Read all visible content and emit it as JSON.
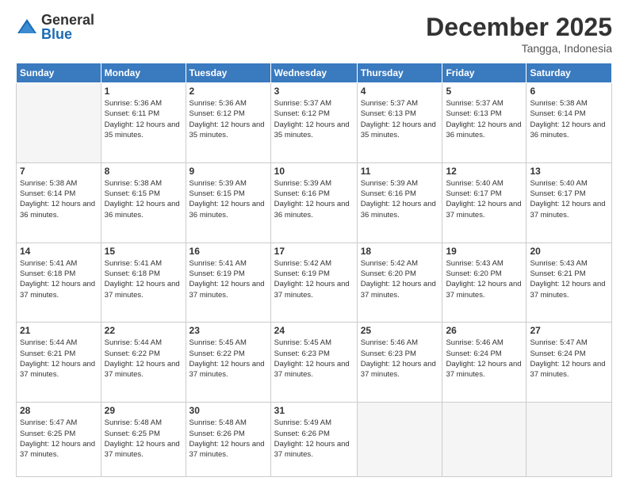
{
  "logo": {
    "general": "General",
    "blue": "Blue"
  },
  "title": "December 2025",
  "subtitle": "Tangga, Indonesia",
  "days_of_week": [
    "Sunday",
    "Monday",
    "Tuesday",
    "Wednesday",
    "Thursday",
    "Friday",
    "Saturday"
  ],
  "weeks": [
    [
      {
        "day": "",
        "sunrise": "",
        "sunset": "",
        "daylight": ""
      },
      {
        "day": "1",
        "sunrise": "5:36 AM",
        "sunset": "6:11 PM",
        "daylight": "12 hours and 35 minutes."
      },
      {
        "day": "2",
        "sunrise": "5:36 AM",
        "sunset": "6:12 PM",
        "daylight": "12 hours and 35 minutes."
      },
      {
        "day": "3",
        "sunrise": "5:37 AM",
        "sunset": "6:12 PM",
        "daylight": "12 hours and 35 minutes."
      },
      {
        "day": "4",
        "sunrise": "5:37 AM",
        "sunset": "6:13 PM",
        "daylight": "12 hours and 35 minutes."
      },
      {
        "day": "5",
        "sunrise": "5:37 AM",
        "sunset": "6:13 PM",
        "daylight": "12 hours and 36 minutes."
      },
      {
        "day": "6",
        "sunrise": "5:38 AM",
        "sunset": "6:14 PM",
        "daylight": "12 hours and 36 minutes."
      }
    ],
    [
      {
        "day": "7",
        "sunrise": "5:38 AM",
        "sunset": "6:14 PM",
        "daylight": "12 hours and 36 minutes."
      },
      {
        "day": "8",
        "sunrise": "5:38 AM",
        "sunset": "6:15 PM",
        "daylight": "12 hours and 36 minutes."
      },
      {
        "day": "9",
        "sunrise": "5:39 AM",
        "sunset": "6:15 PM",
        "daylight": "12 hours and 36 minutes."
      },
      {
        "day": "10",
        "sunrise": "5:39 AM",
        "sunset": "6:16 PM",
        "daylight": "12 hours and 36 minutes."
      },
      {
        "day": "11",
        "sunrise": "5:39 AM",
        "sunset": "6:16 PM",
        "daylight": "12 hours and 36 minutes."
      },
      {
        "day": "12",
        "sunrise": "5:40 AM",
        "sunset": "6:17 PM",
        "daylight": "12 hours and 37 minutes."
      },
      {
        "day": "13",
        "sunrise": "5:40 AM",
        "sunset": "6:17 PM",
        "daylight": "12 hours and 37 minutes."
      }
    ],
    [
      {
        "day": "14",
        "sunrise": "5:41 AM",
        "sunset": "6:18 PM",
        "daylight": "12 hours and 37 minutes."
      },
      {
        "day": "15",
        "sunrise": "5:41 AM",
        "sunset": "6:18 PM",
        "daylight": "12 hours and 37 minutes."
      },
      {
        "day": "16",
        "sunrise": "5:41 AM",
        "sunset": "6:19 PM",
        "daylight": "12 hours and 37 minutes."
      },
      {
        "day": "17",
        "sunrise": "5:42 AM",
        "sunset": "6:19 PM",
        "daylight": "12 hours and 37 minutes."
      },
      {
        "day": "18",
        "sunrise": "5:42 AM",
        "sunset": "6:20 PM",
        "daylight": "12 hours and 37 minutes."
      },
      {
        "day": "19",
        "sunrise": "5:43 AM",
        "sunset": "6:20 PM",
        "daylight": "12 hours and 37 minutes."
      },
      {
        "day": "20",
        "sunrise": "5:43 AM",
        "sunset": "6:21 PM",
        "daylight": "12 hours and 37 minutes."
      }
    ],
    [
      {
        "day": "21",
        "sunrise": "5:44 AM",
        "sunset": "6:21 PM",
        "daylight": "12 hours and 37 minutes."
      },
      {
        "day": "22",
        "sunrise": "5:44 AM",
        "sunset": "6:22 PM",
        "daylight": "12 hours and 37 minutes."
      },
      {
        "day": "23",
        "sunrise": "5:45 AM",
        "sunset": "6:22 PM",
        "daylight": "12 hours and 37 minutes."
      },
      {
        "day": "24",
        "sunrise": "5:45 AM",
        "sunset": "6:23 PM",
        "daylight": "12 hours and 37 minutes."
      },
      {
        "day": "25",
        "sunrise": "5:46 AM",
        "sunset": "6:23 PM",
        "daylight": "12 hours and 37 minutes."
      },
      {
        "day": "26",
        "sunrise": "5:46 AM",
        "sunset": "6:24 PM",
        "daylight": "12 hours and 37 minutes."
      },
      {
        "day": "27",
        "sunrise": "5:47 AM",
        "sunset": "6:24 PM",
        "daylight": "12 hours and 37 minutes."
      }
    ],
    [
      {
        "day": "28",
        "sunrise": "5:47 AM",
        "sunset": "6:25 PM",
        "daylight": "12 hours and 37 minutes."
      },
      {
        "day": "29",
        "sunrise": "5:48 AM",
        "sunset": "6:25 PM",
        "daylight": "12 hours and 37 minutes."
      },
      {
        "day": "30",
        "sunrise": "5:48 AM",
        "sunset": "6:26 PM",
        "daylight": "12 hours and 37 minutes."
      },
      {
        "day": "31",
        "sunrise": "5:49 AM",
        "sunset": "6:26 PM",
        "daylight": "12 hours and 37 minutes."
      },
      {
        "day": "",
        "sunrise": "",
        "sunset": "",
        "daylight": ""
      },
      {
        "day": "",
        "sunrise": "",
        "sunset": "",
        "daylight": ""
      },
      {
        "day": "",
        "sunrise": "",
        "sunset": "",
        "daylight": ""
      }
    ]
  ]
}
